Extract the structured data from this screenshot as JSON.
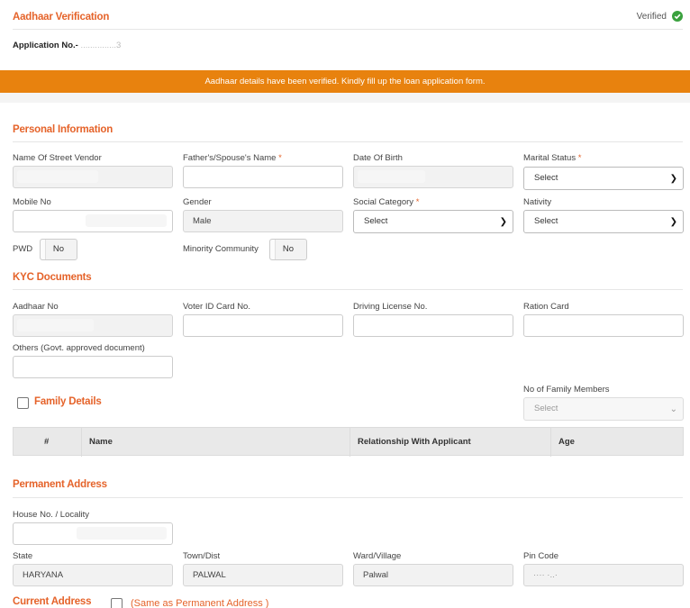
{
  "header": {
    "title": "Aadhaar Verification",
    "status": "Verified",
    "application_label": "Application No.- ",
    "application_no": "...............3"
  },
  "banner": {
    "message": "Aadhaar details have been verified. Kindly fill up the loan application form."
  },
  "personal": {
    "title": "Personal Information",
    "vendor_name_label": "Name Of Street Vendor",
    "father_label": "Father's/Spouse's Name",
    "dob_label": "Date Of Birth",
    "marital_label": "Marital Status",
    "marital_value": "Select",
    "mobile_label": "Mobile No",
    "gender_label": "Gender",
    "gender_value": "Male",
    "social_label": "Social Category",
    "social_value": "Select",
    "nativity_label": "Nativity",
    "nativity_value": "Select",
    "pwd_label": "PWD",
    "pwd_value": "No",
    "minority_label": "Minority Community",
    "minority_value": "No",
    "required_mark": "*"
  },
  "kyc": {
    "title": "KYC Documents",
    "aadhaar_label": "Aadhaar No",
    "voter_label": "Voter ID Card No.",
    "driving_label": "Driving License No.",
    "ration_label": "Ration Card",
    "others_label": "Others (Govt. approved document)"
  },
  "family": {
    "title": "Family Details",
    "count_label": "No of Family Members",
    "count_value": "Select",
    "columns": [
      "#",
      "Name",
      "Relationship With Applicant",
      "Age"
    ]
  },
  "permanent": {
    "title": "Permanent Address",
    "house_label": "House No. / Locality",
    "state_label": "State",
    "state_value": "HARYANA",
    "town_label": "Town/Dist",
    "town_value": "PALWAL",
    "ward_label": "Ward/Village",
    "ward_value": "Palwal",
    "pin_label": "Pin Code",
    "pin_value": "···· ·..·"
  },
  "current": {
    "title": "Current Address",
    "same_as_label": "(Same as Permanent Address )"
  },
  "colors": {
    "accent": "#e5632a",
    "banner": "#e8820e",
    "verified": "#3aa13e"
  }
}
